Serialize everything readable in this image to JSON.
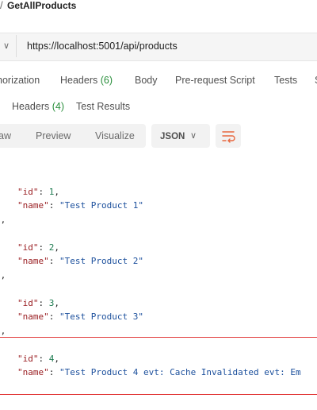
{
  "request": {
    "title_prefix": "/",
    "title": "GetAllProducts",
    "url": "https://localhost:5001/api/products"
  },
  "request_tabs": [
    {
      "label": "horization",
      "count": ""
    },
    {
      "label": "Headers",
      "count": "(6)"
    },
    {
      "label": "Body",
      "count": ""
    },
    {
      "label": "Pre-request Script",
      "count": ""
    },
    {
      "label": "Tests",
      "count": ""
    },
    {
      "label": "S",
      "count": ""
    }
  ],
  "response_tabs": [
    {
      "label": "Headers",
      "count": "(4)"
    },
    {
      "label": "Test Results",
      "count": ""
    }
  ],
  "view_buttons": [
    "aw",
    "Preview",
    "Visualize"
  ],
  "format": {
    "selected": "JSON"
  },
  "icons": {
    "chevron": "chevron-down-icon",
    "wrap": "wrap-lines-icon"
  },
  "colors": {
    "key": "#9a1f23",
    "string": "#1b4f9c",
    "number": "#1b7a4f",
    "highlight": "#e23b3b"
  },
  "json_body": {
    "items": [
      {
        "id_key": "\"id\"",
        "id_value": "1",
        "name_key": "\"name\"",
        "name_value": "\"Test Product 1\"",
        "trailing": "},"
      },
      {
        "id_key": "\"id\"",
        "id_value": "2",
        "name_key": "\"name\"",
        "name_value": "\"Test Product 2\"",
        "trailing": "},"
      },
      {
        "id_key": "\"id\"",
        "id_value": "3",
        "name_key": "\"name\"",
        "name_value": "\"Test Product 3\"",
        "trailing": "},"
      },
      {
        "id_key": "\"id\"",
        "id_value": "4",
        "name_key": "\"name\"",
        "name_value": "\"Test Product 4 evt: Cache Invalidated evt: Em",
        "trailing": ""
      }
    ]
  }
}
